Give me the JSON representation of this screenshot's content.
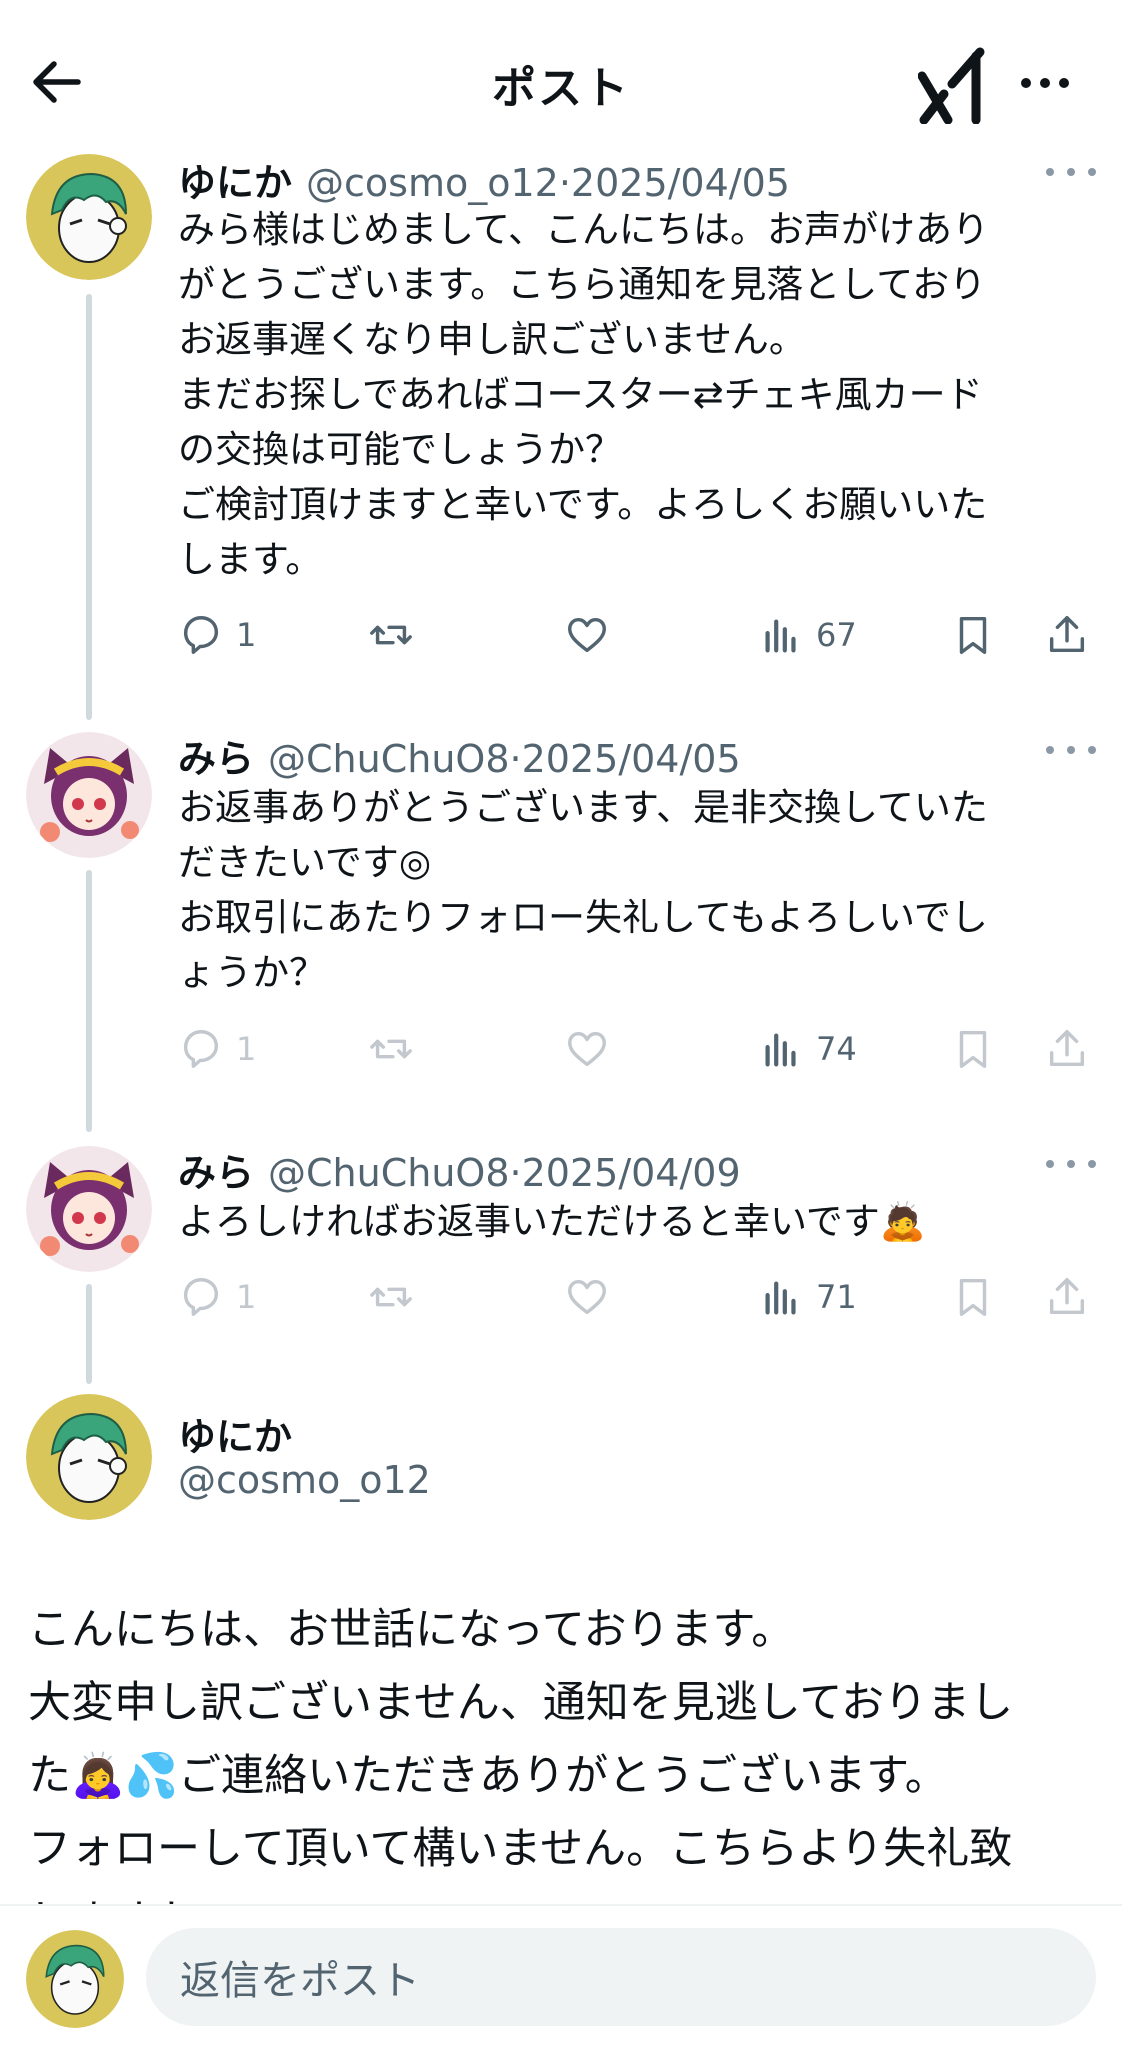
{
  "header": {
    "title": "ポスト",
    "back_icon": "arrow-left-icon",
    "grok_icon": "grok-icon",
    "more_icon": "more-horizontal-icon"
  },
  "thread": [
    {
      "name": "ゆにか",
      "handle": "@cosmo_o12",
      "date": "2025/04/05",
      "text": "みら様はじめまして、こんにちは。お声がけあり\nがとうございます。こちら通知を見落としており\nお返事遅くなり申し訳ございません。\nまだお探しであればコースター⇄チェキ風カード\nの交換は可能でしょうか？\nご検討頂けますと幸いです。よろしくお願いいた\nします。",
      "replies": "1",
      "views": "67"
    },
    {
      "name": "みら",
      "handle": "@ChuChuO8",
      "date": "2025/04/05",
      "text": "お返事ありがとうございます、是非交換していた\nだきたいです◎\nお取引にあたりフォロー失礼してもよろしいでし\nょうか？",
      "replies": "1",
      "views": "74"
    },
    {
      "name": "みら",
      "handle": "@ChuChuO8",
      "date": "2025/04/09",
      "text": "よろしければお返事いただけると幸いです🙇",
      "replies": "1",
      "views": "71"
    }
  ],
  "main_post": {
    "name": "ゆにか",
    "handle": "@cosmo_o12",
    "text": "こんにちは、お世話になっております。\n大変申し訳ございません、通知を見逃しておりまし\nた🙇‍♀️💦ご連絡いただきありがとうございます。\nフォローして頂いて構いません。こちらより失礼致\nしますね。"
  },
  "reply_bar": {
    "placeholder": "返信をポスト"
  },
  "colors": {
    "text": "#0f1419",
    "secondary": "#536471",
    "thread_line": "#cfd9de",
    "input_bg": "#eff3f4"
  }
}
